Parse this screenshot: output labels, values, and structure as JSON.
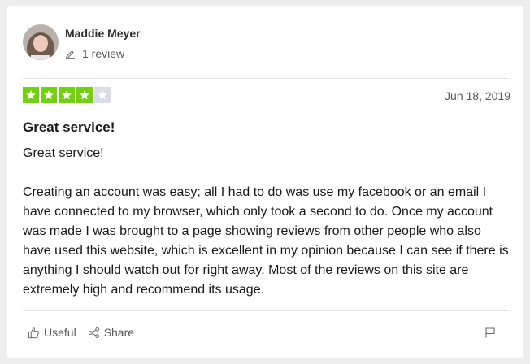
{
  "reviewer": {
    "name": "Maddie Meyer",
    "review_count": "1 review",
    "avatar_icon": "avatar-photo"
  },
  "review": {
    "rating": 4,
    "rating_max": 5,
    "star_color": "#73cf11",
    "star_empty_color": "#dcdce6",
    "date": "Jun 18, 2019",
    "title": "Great service!",
    "paragraphs": [
      "Great service!",
      "Creating an account was easy; all I had to do was use my facebook or an email I have connected to my browser, which only took a second to do. Once my account was made I was brought to a page showing reviews from other people who also have used this website, which is excellent in my opinion because I can see if there is anything I should watch out for right away. Most of the reviews on this site are extremely high and recommend its usage."
    ]
  },
  "actions": {
    "useful_label": "Useful",
    "useful_icon": "thumbs-up-icon",
    "share_label": "Share",
    "share_icon": "share-icon",
    "flag_icon": "flag-icon"
  }
}
